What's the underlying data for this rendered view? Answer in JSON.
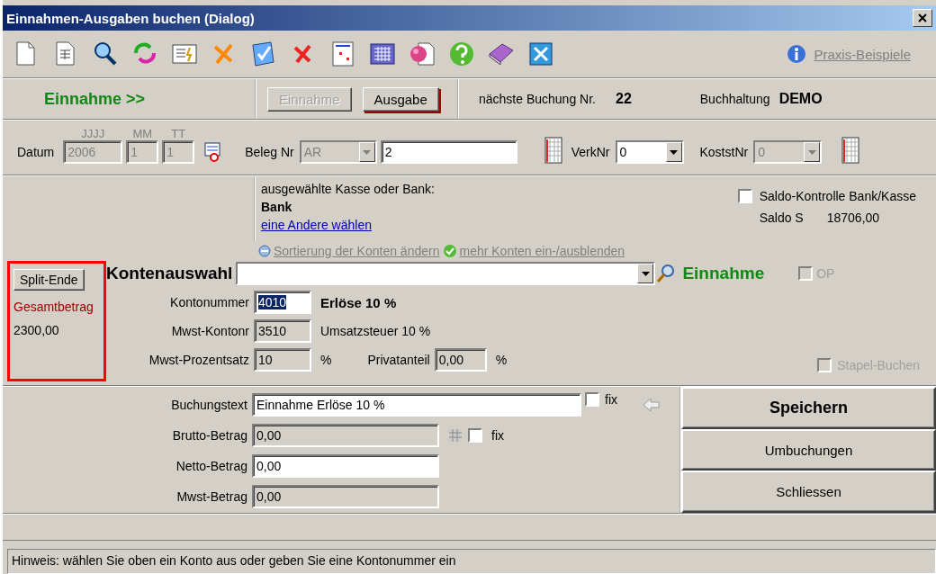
{
  "window": {
    "title": "Einnahmen-Ausgaben buchen (Dialog)"
  },
  "toolbar": {
    "help_link": "Praxis-Beispiele"
  },
  "header": {
    "mode": "Einnahme >>",
    "mode_buttons": [
      {
        "label": "Einnahme",
        "disabled": true,
        "focused": false
      },
      {
        "label": "Ausgabe",
        "disabled": false,
        "focused": true
      }
    ],
    "next_booking": {
      "label": "nächste Buchung Nr.",
      "value": "22"
    },
    "bookkeeping": {
      "label": "Buchhaltung",
      "value": "DEMO"
    }
  },
  "date": {
    "label": "Datum",
    "parts": [
      {
        "caption": "JJJJ",
        "value": "2006",
        "disabled": true
      },
      {
        "caption": "MM",
        "value": "1",
        "disabled": true
      },
      {
        "caption": "TT",
        "value": "1",
        "disabled": true
      }
    ]
  },
  "receipt": {
    "label": "Beleg Nr",
    "prefix": "AR",
    "prefix_disabled": true,
    "number": "2"
  },
  "combos": [
    {
      "label": "VerkNr",
      "value": "0",
      "disabled": false
    },
    {
      "label": "KoststNr",
      "value": "0",
      "disabled": true
    }
  ],
  "account_source": {
    "caption": "ausgewählte Kasse oder Bank:",
    "name": "Bank",
    "link": "eine Andere wählen"
  },
  "saldo": {
    "label": "Saldo-Kontrolle Bank/Kasse",
    "checked": false,
    "side": "Saldo S",
    "value": "18706,00"
  },
  "account_links": [
    "Sortierung der Konten ändern",
    "mehr Konten ein-/ausblenden"
  ],
  "split": {
    "button": "Split-Ende",
    "label": "Gesamtbetrag",
    "value": "2300,00"
  },
  "account_select": {
    "label": "Kontenauswahl",
    "type_label": "Einnahme",
    "op": {
      "label": "OP",
      "checked": false,
      "disabled": true
    }
  },
  "account_number": {
    "label": "Kontonummer",
    "value": "4010",
    "selected": true,
    "description": "Erlöse 10 %"
  },
  "tax_account": {
    "label": "Mwst-Kontonr",
    "value": "3510",
    "disabled": true,
    "description": "Umsatzsteuer 10 %"
  },
  "tax_rate": {
    "label": "Mwst-Prozentsatz",
    "value": "10",
    "disabled": true,
    "unit": "%",
    "private_label": "Privatanteil",
    "private_value": "0,00",
    "private_disabled": true,
    "private_unit": "%"
  },
  "batch": {
    "label": "Stapel-Buchen",
    "checked": false,
    "disabled": true
  },
  "booking_text": {
    "label": "Buchungstext",
    "value": "Einnahme Erlöse 10 %",
    "fix_label": "fix",
    "fix_checked": false
  },
  "amounts": [
    {
      "label": "Brutto-Betrag",
      "value": "0,00",
      "disabled": true,
      "fix_label": "fix",
      "fix_checked": false
    },
    {
      "label": "Netto-Betrag",
      "value": "0,00",
      "disabled": false
    },
    {
      "label": "Mwst-Betrag",
      "value": "0,00",
      "disabled": true
    }
  ],
  "actions": [
    {
      "label": "Speichern",
      "default": true
    },
    {
      "label": "Umbuchungen",
      "default": false
    },
    {
      "label": "Schliessen",
      "default": false
    }
  ],
  "status_bar": "Hinweis: wählen Sie oben ein Konto aus oder geben Sie eine Kontonummer ein"
}
